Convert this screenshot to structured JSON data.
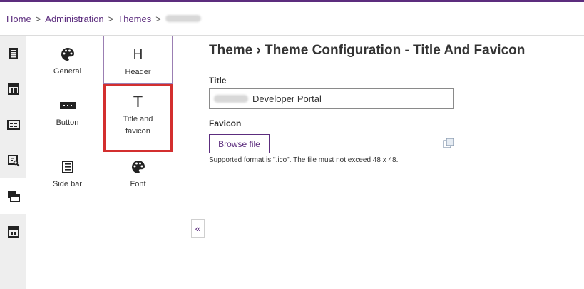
{
  "breadcrumb": {
    "items": [
      "Home",
      "Administration",
      "Themes"
    ],
    "separator": ">"
  },
  "rail": {
    "items": [
      {
        "icon": "list-document-icon"
      },
      {
        "icon": "layout-icon"
      },
      {
        "icon": "card-icon"
      },
      {
        "icon": "search-document-icon"
      },
      {
        "icon": "theme-icon",
        "active": true
      },
      {
        "icon": "window-icon"
      }
    ]
  },
  "panel": {
    "tiles": [
      {
        "label": "General",
        "icon": "palette-icon"
      },
      {
        "label": "Header",
        "icon": "H"
      },
      {
        "label": "Button",
        "icon": "button-icon"
      },
      {
        "label": "Title and favicon",
        "icon": "T",
        "selected": true
      },
      {
        "label": "Side bar",
        "icon": "sidebar-icon"
      },
      {
        "label": "Font",
        "icon": "palette-icon"
      }
    ]
  },
  "main": {
    "title": "Theme › Theme Configuration - Title And Favicon",
    "title_label": "Title",
    "title_value": "Developer Portal",
    "favicon_label": "Favicon",
    "browse_label": "Browse file",
    "hint": "Supported format is \".ico\". The file must not exceed 48 x 48."
  },
  "colors": {
    "accent": "#5c2d7e",
    "selection_border": "#d32f2f",
    "rail_bg": "#eeeeee"
  }
}
